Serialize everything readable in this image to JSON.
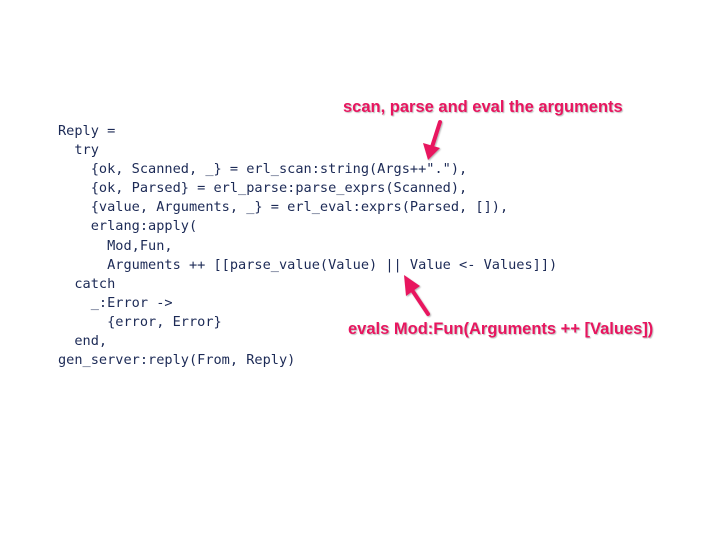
{
  "code_lines": [
    "Reply =",
    "  try",
    "    {ok, Scanned, _} = erl_scan:string(Args++\".\"),",
    "    {ok, Parsed} = erl_parse:parse_exprs(Scanned),",
    "    {value, Arguments, _} = erl_eval:exprs(Parsed, []),",
    "    erlang:apply(",
    "      Mod,Fun,",
    "      Arguments ++ [[parse_value(Value) || Value <- Values]])",
    "  catch",
    "    _:Error ->",
    "      {error, Error}",
    "  end,",
    "gen_server:reply(From, Reply)"
  ],
  "annotations": {
    "top": "scan, parse and eval the arguments",
    "bottom": "evals Mod:Fun(Arguments ++ [Values])"
  },
  "colors": {
    "code": "#1c2a56",
    "accent": "#e8155f"
  }
}
